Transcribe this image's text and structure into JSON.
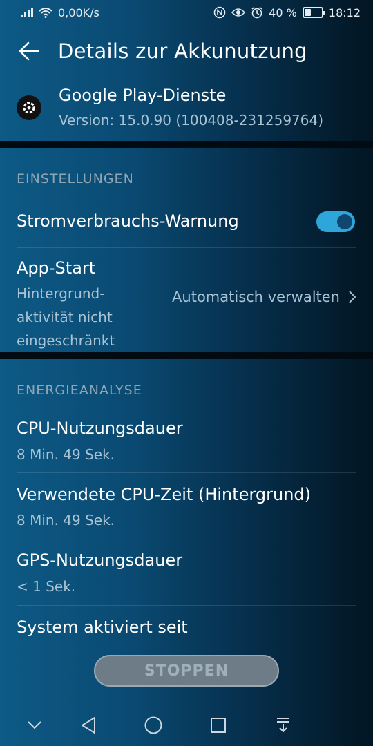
{
  "status": {
    "speed": "0,00K/s",
    "battery": "40 %",
    "battery_level": 0.4,
    "time": "18:12"
  },
  "header": {
    "title": "Details zur Akkunutzung",
    "back_icon": "arrow-left-icon"
  },
  "app": {
    "name": "Google Play-Dienste",
    "version": "Version: 15.0.90 (100408-231259764)",
    "icon": "gear-icon"
  },
  "settings": {
    "section_label": "EINSTELLUNGEN",
    "power_warning": {
      "label": "Stromverbrauchs-Warnung",
      "enabled": true
    },
    "app_start": {
      "label": "App-Start",
      "description": "Hintergrund-aktivität nicht eingeschränkt",
      "value": "Automatisch verwalten"
    }
  },
  "energy": {
    "section_label": "ENERGIEANALYSE",
    "items": [
      {
        "label": "CPU-Nutzungsdauer",
        "value": "8 Min. 49 Sek."
      },
      {
        "label": "Verwendete CPU-Zeit (Hintergrund)",
        "value": "8 Min. 49 Sek."
      },
      {
        "label": "GPS-Nutzungsdauer",
        "value": "< 1 Sek."
      },
      {
        "label": "System aktiviert seit",
        "value": ""
      }
    ]
  },
  "stop_button": {
    "label": "STOPPEN"
  },
  "colors": {
    "accent": "#2fa6da",
    "background": "#0a4a72"
  }
}
